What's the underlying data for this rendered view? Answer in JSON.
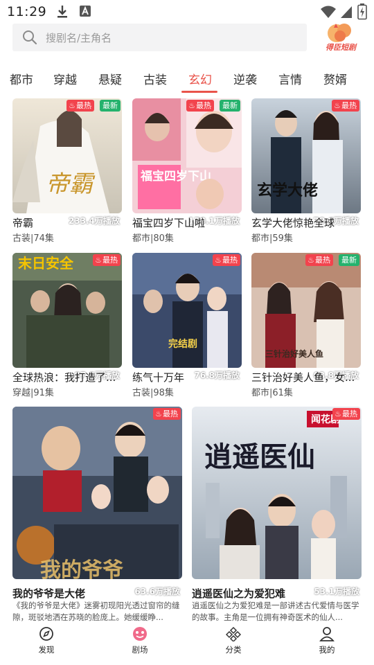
{
  "status_bar": {
    "time": "11:29"
  },
  "search": {
    "placeholder": "搜剧名/主角名"
  },
  "brand": {
    "text": "得臣短剧"
  },
  "tabs": [
    "都市",
    "穿越",
    "悬疑",
    "古装",
    "玄幻",
    "逆袭",
    "言情",
    "赘婿"
  ],
  "active_tab": "玄幻",
  "badges": {
    "hot": "最热",
    "new": "最新"
  },
  "cards": [
    {
      "title": "帝霸",
      "meta": "古装|74集",
      "plays": "233.4万播放",
      "hot": true,
      "new": true,
      "poster_text": "帝霸"
    },
    {
      "title": "福宝四岁下山啦",
      "meta": "都市|80集",
      "plays": "170.1万播放",
      "hot": true,
      "new": true,
      "poster_text": "福宝四岁下山"
    },
    {
      "title": "玄学大佬惊艳全球",
      "meta": "都市|59集",
      "plays": "78.6万播放",
      "hot": true,
      "new": false,
      "poster_text": "玄学大佬"
    },
    {
      "title": "全球热浪：我打造了...",
      "meta": "穿越|91集",
      "plays": "87.9万播放",
      "hot": true,
      "new": false,
      "poster_text": "末日安全"
    },
    {
      "title": "练气十万年",
      "meta": "古装|98集",
      "plays": "76.8万播放",
      "hot": true,
      "new": false,
      "poster_text": "完结剧"
    },
    {
      "title": "三针治好美人鱼，女...",
      "meta": "都市|61集",
      "plays": "63.8万播放",
      "hot": true,
      "new": true,
      "poster_text": "三针治好美人鱼"
    },
    {
      "title": "我的爷爷是大佬",
      "desc": "《我的爷爷是大佬》迷雾初现阳光透过窗帘的缝隙，斑驳地洒在苏晓的脸庞上。她缓缓睁...",
      "plays": "63.6万播放",
      "hot": true,
      "new": false,
      "poster_text": "我的爷爷"
    },
    {
      "title": "逍遥医仙之为爱犯难",
      "desc": "逍遥医仙之为爱犯难是一部讲述古代爱情与医学的故事。主角是一位拥有神奇医术的仙人...",
      "plays": "53.1万播放",
      "hot": true,
      "new": false,
      "poster_text": "逍遥医仙",
      "tag": "闻花剧"
    }
  ],
  "nav": [
    {
      "label": "发现",
      "icon": "compass-icon"
    },
    {
      "label": "剧场",
      "icon": "theater-icon",
      "active": true
    },
    {
      "label": "分类",
      "icon": "category-icon"
    },
    {
      "label": "我的",
      "icon": "user-icon"
    }
  ],
  "colors": {
    "accent": "#e9534a",
    "hot_badge": "#f2434d",
    "new_badge": "#24b26d"
  }
}
